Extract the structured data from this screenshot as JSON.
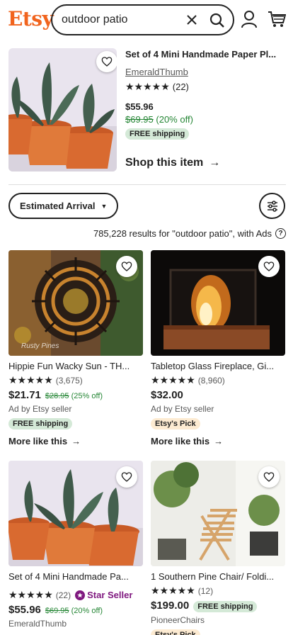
{
  "header": {
    "logo": "Etsy",
    "search_value": "outdoor patio"
  },
  "featured": {
    "title": "Set of 4 Mini Handmade Paper Pl...",
    "shop": "EmeraldThumb",
    "stars": "★★★★★",
    "reviews": "(22)",
    "price": "$55.96",
    "original_price": "$69.95",
    "discount": "(20% off)",
    "shipping": "FREE shipping",
    "cta": "Shop this item",
    "arrow": "→"
  },
  "filters": {
    "sort_label": "Estimated Arrival",
    "sort_caret": "▼",
    "results_text": "785,228 results for \"outdoor patio\", with Ads",
    "info": "?"
  },
  "listings": [
    {
      "title": "Hippie Fun Wacky Sun - TH...",
      "stars": "★★★★★",
      "reviews": "(3,675)",
      "price": "$21.71",
      "original_price": "$28.95",
      "discount": "(25% off)",
      "ad": "Ad by Etsy seller",
      "badge": "FREE shipping",
      "more": "More like this",
      "watermark": "Rusty Pines"
    },
    {
      "title": "Tabletop Glass Fireplace, Gi...",
      "stars": "★★★★★",
      "reviews": "(8,960)",
      "price": "$32.00",
      "ad": "Ad by Etsy seller",
      "badge": "Etsy's Pick",
      "more": "More like this"
    },
    {
      "title": "Set of 4 Mini Handmade Pa...",
      "stars": "★★★★★",
      "reviews": "(22)",
      "star_seller": "Star Seller",
      "price": "$55.96",
      "original_price": "$69.95",
      "discount": "(20% off)",
      "shop": "EmeraldThumb"
    },
    {
      "title": "1 Southern Pine Chair/ Foldi...",
      "stars": "★★★★★",
      "reviews": "(12)",
      "price": "$199.00",
      "badge": "FREE shipping",
      "shop": "PioneerChairs",
      "badge2": "Etsy's Pick"
    }
  ],
  "colors": {
    "brand": "#F1641E",
    "sale_green": "#258635",
    "ship_bg": "#D4E9D7",
    "pick_bg": "#FDEBD2",
    "star_seller": "#7F187F"
  }
}
